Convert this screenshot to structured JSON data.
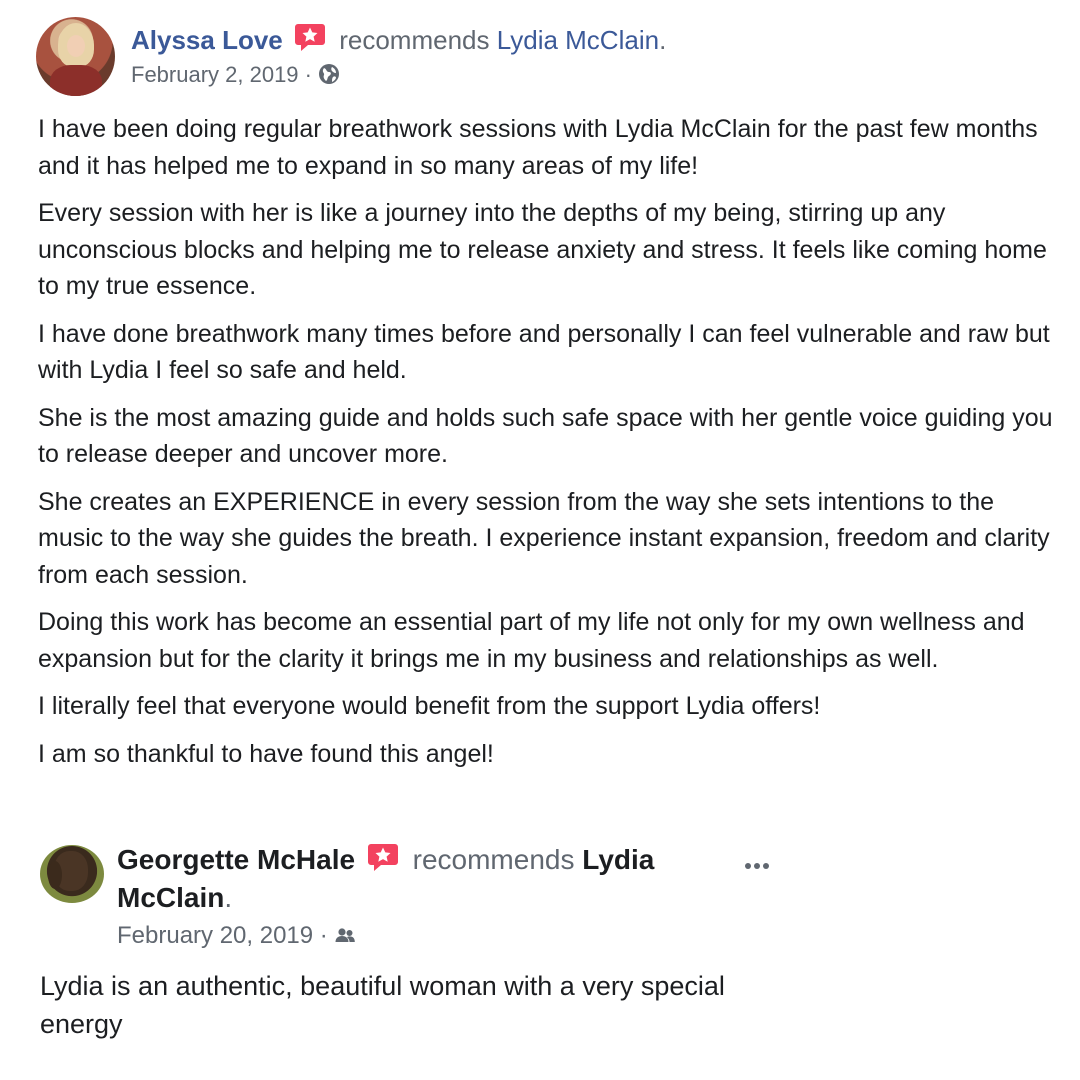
{
  "reviews": [
    {
      "author": "Alyssa Love",
      "action": "recommends",
      "target": "Lydia McClain",
      "punctuation": ".",
      "date": "February 2, 2019",
      "separator": " · ",
      "audience_icon": "globe-icon",
      "paragraphs": [
        "I have been doing regular breathwork sessions with Lydia McClain for the past few months and it has helped me to expand in so many areas of my life!",
        "Every session with her is like a journey into the depths of my being, stirring up any unconscious blocks and helping me to release anxiety and stress. It feels like coming home to my true essence.",
        "I have done breathwork many times before and personally I can feel vulnerable and raw but with Lydia I feel so safe and held.",
        "She is the most amazing guide and holds such safe space with her gentle voice guiding you to release deeper and uncover more.",
        "She creates an EXPERIENCE in every session from the way she sets intentions to the music to the way she guides the breath. I experience instant expansion, freedom and clarity from each session.",
        "Doing this work has become an essential part of my life not only for my own wellness and expansion but for the clarity it brings me in my business and relationships as well.",
        "I literally feel that everyone would benefit from the support Lydia offers!",
        "I am so thankful to have found this angel!"
      ]
    },
    {
      "author": "Georgette McHale",
      "action": "recommends",
      "target_line1": "Lydia",
      "target_line2": "McClain",
      "punctuation": ".",
      "date": "February 20, 2019",
      "separator": " · ",
      "audience_icon": "friends-icon",
      "paragraphs": [
        "Lydia is an authentic, beautiful woman with a very special energy"
      ]
    }
  ],
  "colors": {
    "link": "#3b5998",
    "secondary_text": "#606770",
    "primary_text": "#1c1e21",
    "recommend_badge": "#f3425f"
  },
  "icons": {
    "recommend_badge": "star-badge-icon",
    "more_options": "more-options-icon"
  }
}
